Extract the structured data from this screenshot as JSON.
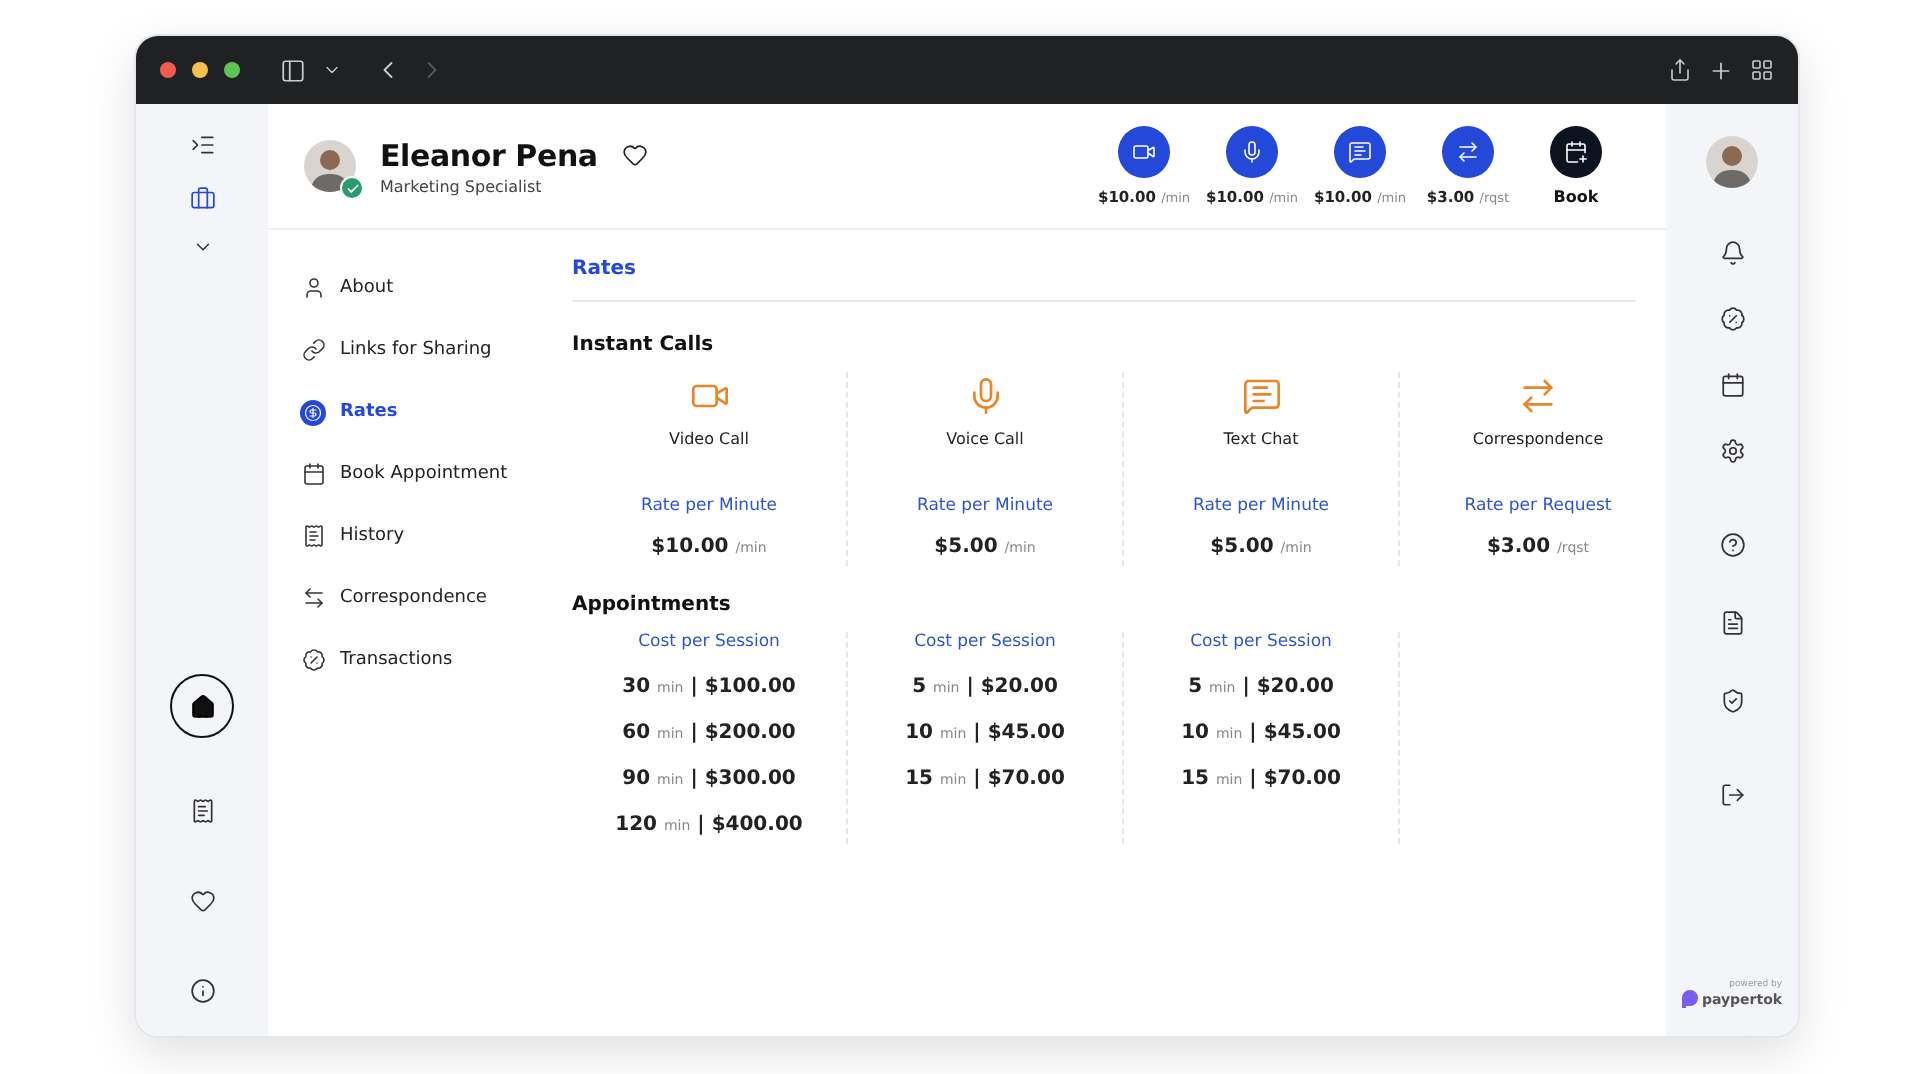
{
  "profile": {
    "name": "Eleanor Pena",
    "role": "Marketing Specialist",
    "verified": true
  },
  "actions": [
    {
      "kind": "rate",
      "price": "$10.00",
      "unit": "/min"
    },
    {
      "kind": "rate",
      "price": "$10.00",
      "unit": "/min"
    },
    {
      "kind": "rate",
      "price": "$10.00",
      "unit": "/min"
    },
    {
      "kind": "rate",
      "price": "$3.00",
      "unit": "/rqst"
    },
    {
      "kind": "book",
      "label": "Book"
    }
  ],
  "left_rail": [
    {
      "selected": false
    },
    {
      "selected": true
    }
  ],
  "nav": [
    {
      "label": "About",
      "selected": false
    },
    {
      "label": "Links for Sharing",
      "selected": false
    },
    {
      "label": "Rates",
      "selected": true
    },
    {
      "label": "Book Appointment",
      "selected": false
    },
    {
      "label": "History",
      "selected": false
    },
    {
      "label": "Correspondence",
      "selected": false
    },
    {
      "label": "Transactions",
      "selected": false
    }
  ],
  "section_title": "Rates",
  "instant_calls": {
    "title": "Instant Calls",
    "items": [
      {
        "name": "Video Call",
        "rate_label": "Rate per Minute",
        "price": "$10.00",
        "unit": "/min"
      },
      {
        "name": "Voice Call",
        "rate_label": "Rate per Minute",
        "price": "$5.00",
        "unit": "/min"
      },
      {
        "name": "Text Chat",
        "rate_label": "Rate per Minute",
        "price": "$5.00",
        "unit": "/min"
      },
      {
        "name": "Correspondence",
        "rate_label": "Rate per Request",
        "price": "$3.00",
        "unit": "/rqst"
      }
    ]
  },
  "appointments": {
    "title": "Appointments",
    "separator": "|",
    "columns": [
      {
        "label": "Cost per Session",
        "rows": [
          {
            "minutes": "30",
            "unit": "min",
            "price": "$100.00"
          },
          {
            "minutes": "60",
            "unit": "min",
            "price": "$200.00"
          },
          {
            "minutes": "90",
            "unit": "min",
            "price": "$300.00"
          },
          {
            "minutes": "120",
            "unit": "min",
            "price": "$400.00"
          }
        ]
      },
      {
        "label": "Cost per Session",
        "rows": [
          {
            "minutes": "5",
            "unit": "min",
            "price": "$20.00"
          },
          {
            "minutes": "10",
            "unit": "min",
            "price": "$45.00"
          },
          {
            "minutes": "15",
            "unit": "min",
            "price": "$70.00"
          }
        ]
      },
      {
        "label": "Cost per Session",
        "rows": [
          {
            "minutes": "5",
            "unit": "min",
            "price": "$20.00"
          },
          {
            "minutes": "10",
            "unit": "min",
            "price": "$45.00"
          },
          {
            "minutes": "15",
            "unit": "min",
            "price": "$70.00"
          }
        ]
      }
    ]
  },
  "powered_by": {
    "caption": "powered by",
    "brand": "paypertok"
  }
}
